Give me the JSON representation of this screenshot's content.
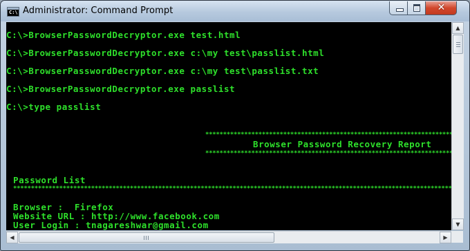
{
  "window": {
    "title": "Administrator: Command Prompt",
    "icon_name": "cmd-icon",
    "icon_text": "C:\\"
  },
  "controls": {
    "minimize_icon": "minimize-icon",
    "maximize_icon": "maximize-icon",
    "close_icon": "close-icon",
    "close_glyph": "✕"
  },
  "console": {
    "text_color": "#2ee02b",
    "background": "#000000",
    "lines": [
      "C:\\>BrowserPasswordDecryptor.exe test.html",
      "C:\\>BrowserPasswordDecryptor.exe c:\\my test\\passlist.html",
      "C:\\>BrowserPasswordDecryptor.exe c:\\my test\\passlist.txt",
      "C:\\>BrowserPasswordDecryptor.exe passlist",
      "C:\\>type passlist"
    ],
    "report_border": "******************************************************************************************",
    "report_title": "Browser Password Recovery Report",
    "section_title": "Password List",
    "section_border": "****************************************************************************************************************************************",
    "entry": {
      "browser": "Browser :  Firefox",
      "website": "Website URL : http://www.facebook.com",
      "login": "User Login : tnagareshwar@gmail.com"
    }
  },
  "scrollbars": {
    "up_arrow": "▲",
    "down_arrow": "▼",
    "left_arrow": "◀",
    "right_arrow": "▶"
  }
}
